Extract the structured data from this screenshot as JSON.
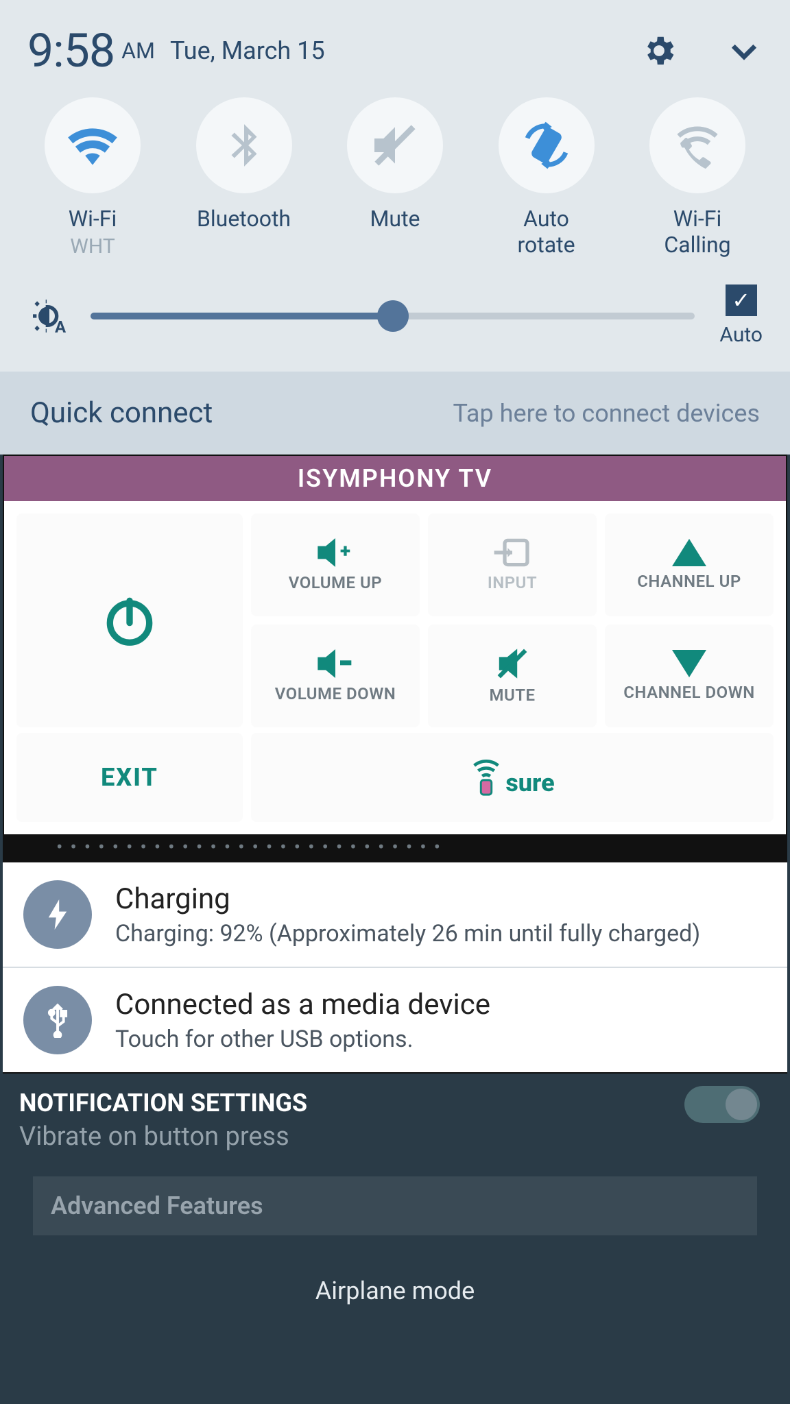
{
  "status": {
    "time": "9:58",
    "ampm": "AM",
    "date": "Tue, March 15"
  },
  "qs": {
    "wifi": {
      "label": "Wi-Fi",
      "sub": "WHT"
    },
    "bt": {
      "label": "Bluetooth"
    },
    "mute": {
      "label": "Mute"
    },
    "rotate": {
      "label": "Auto\nrotate"
    },
    "wfc": {
      "label": "Wi-Fi\nCalling"
    }
  },
  "brightness": {
    "auto_label": "Auto",
    "auto_checked": true,
    "percent": 50
  },
  "qc": {
    "title": "Quick connect",
    "hint": "Tap here to connect devices"
  },
  "tv": {
    "header": "ISYMPHONY TV",
    "vol_up": "VOLUME UP",
    "vol_down": "VOLUME DOWN",
    "input": "INPUT",
    "mute": "MUTE",
    "ch_up": "CHANNEL UP",
    "ch_down": "CHANNEL DOWN",
    "exit": "EXIT",
    "logo": "sure"
  },
  "notif": {
    "charging": {
      "title": "Charging",
      "text": "Charging: 92% (Approximately 26 min until fully charged)"
    },
    "usb": {
      "title": "Connected as a media device",
      "text": "Touch for other USB options."
    }
  },
  "bg": {
    "vibrate_word": "Vibrate",
    "heading": "NOTIFICATION SETTINGS",
    "sub": "Vibrate on button press",
    "adv": "Advanced Features",
    "airplane": "Airplane mode"
  }
}
